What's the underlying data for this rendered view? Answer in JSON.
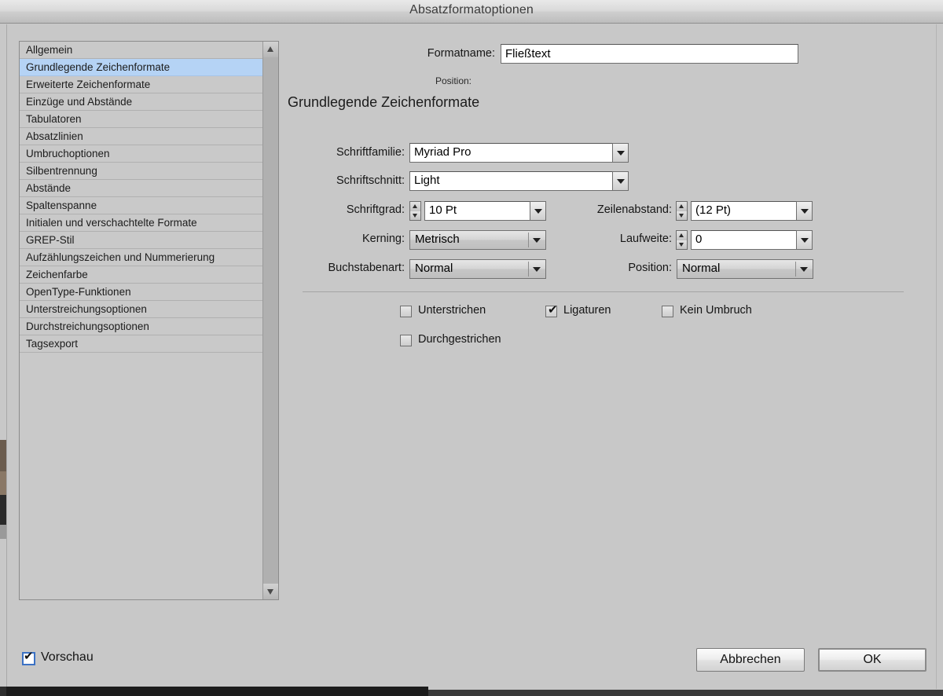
{
  "window": {
    "title": "Absatzformatoptionen"
  },
  "sidebar": {
    "items": [
      {
        "label": "Allgemein",
        "selected": false
      },
      {
        "label": "Grundlegende Zeichenformate",
        "selected": true
      },
      {
        "label": "Erweiterte Zeichenformate",
        "selected": false
      },
      {
        "label": "Einzüge und Abstände",
        "selected": false
      },
      {
        "label": "Tabulatoren",
        "selected": false
      },
      {
        "label": "Absatzlinien",
        "selected": false
      },
      {
        "label": "Umbruchoptionen",
        "selected": false
      },
      {
        "label": "Silbentrennung",
        "selected": false
      },
      {
        "label": "Abstände",
        "selected": false
      },
      {
        "label": "Spaltenspanne",
        "selected": false
      },
      {
        "label": "Initialen und verschachtelte Formate",
        "selected": false
      },
      {
        "label": "GREP-Stil",
        "selected": false
      },
      {
        "label": "Aufzählungszeichen und Nummerierung",
        "selected": false
      },
      {
        "label": "Zeichenfarbe",
        "selected": false
      },
      {
        "label": "OpenType-Funktionen",
        "selected": false
      },
      {
        "label": "Unterstreichungsoptionen",
        "selected": false
      },
      {
        "label": "Durchstreichungsoptionen",
        "selected": false
      },
      {
        "label": "Tagsexport",
        "selected": false
      }
    ],
    "scrollbar": {
      "up_arrow": "triangle-up-icon",
      "down_arrow": "triangle-down-icon"
    }
  },
  "header": {
    "format_name_label": "Formatname:",
    "format_name_value": "Fließtext",
    "position_label": "Position:",
    "position_value": "",
    "section_heading": "Grundlegende Zeichenformate"
  },
  "fields": {
    "font_family": {
      "label": "Schriftfamilie:",
      "value": "Myriad Pro"
    },
    "font_style": {
      "label": "Schriftschnitt:",
      "value": "Light"
    },
    "font_size": {
      "label": "Schriftgrad:",
      "value": "10 Pt"
    },
    "leading": {
      "label": "Zeilenabstand:",
      "value": "(12 Pt)"
    },
    "kerning": {
      "label": "Kerning:",
      "value": "Metrisch"
    },
    "tracking": {
      "label": "Laufweite:",
      "value": "0"
    },
    "case": {
      "label": "Buchstabenart:",
      "value": "Normal"
    },
    "position": {
      "label": "Position:",
      "value": "Normal"
    }
  },
  "checkboxes": [
    {
      "label": "Unterstrichen",
      "checked": false
    },
    {
      "label": "Ligaturen",
      "checked": true
    },
    {
      "label": "Kein Umbruch",
      "checked": false
    },
    {
      "label": "Durchgestrichen",
      "checked": false
    }
  ],
  "footer": {
    "preview_label": "Vorschau",
    "preview_checked": true,
    "cancel_label": "Abbrechen",
    "ok_label": "OK"
  },
  "glyphs": {
    "check": "✔"
  },
  "colors": {
    "dialog_background": "#c8c8c8",
    "selection_blue": "#b5d3f5",
    "focus_blue": "#3c72c4",
    "field_white": "#ffffff",
    "text": "#141414"
  }
}
